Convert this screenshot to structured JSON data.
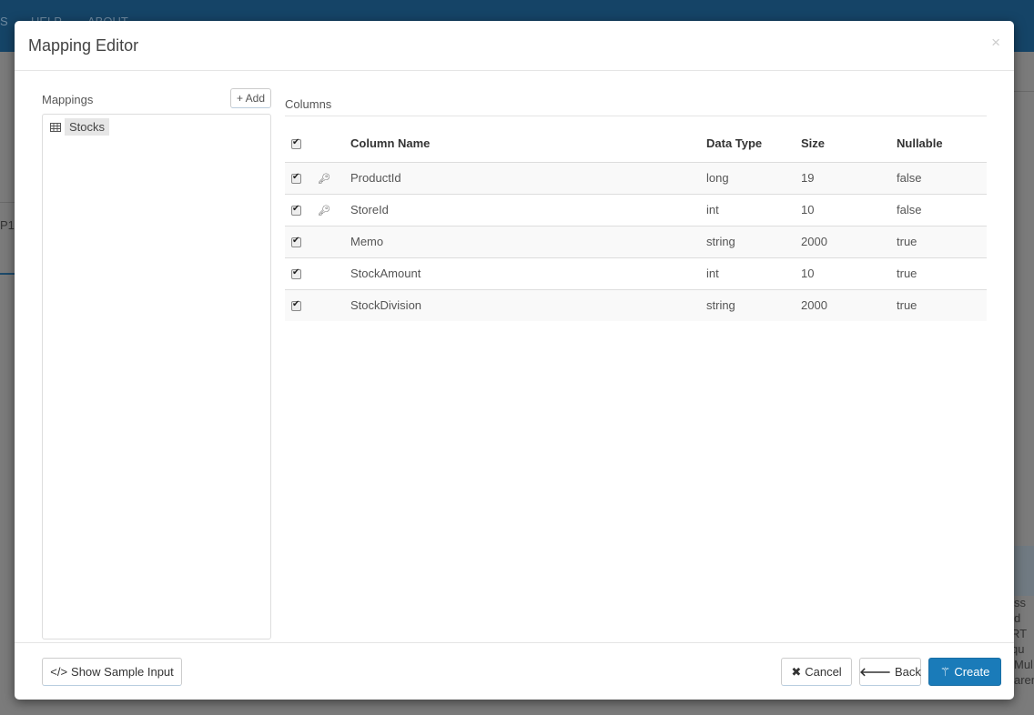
{
  "background": {
    "nav": [
      "S",
      "HELP",
      "ABOUT"
    ],
    "fragments": [
      "P1",
      "ss d",
      "RT qu",
      "Mul",
      "aren"
    ]
  },
  "modal": {
    "title": "Mapping Editor",
    "close": "×"
  },
  "mappings": {
    "header": "Mappings",
    "add_label": "+ Add",
    "items": [
      {
        "label": "Stocks",
        "icon": "table-icon"
      }
    ]
  },
  "columns": {
    "header": "Columns",
    "table_headers": [
      "Column Name",
      "Data Type",
      "Size",
      "Nullable"
    ],
    "rows": [
      {
        "checked": true,
        "key": true,
        "name": "ProductId",
        "type": "long",
        "size": "19",
        "nullable": "false"
      },
      {
        "checked": true,
        "key": true,
        "name": "StoreId",
        "type": "int",
        "size": "10",
        "nullable": "false"
      },
      {
        "checked": true,
        "key": false,
        "name": "Memo",
        "type": "string",
        "size": "2000",
        "nullable": "true"
      },
      {
        "checked": true,
        "key": false,
        "name": "StockAmount",
        "type": "int",
        "size": "10",
        "nullable": "true"
      },
      {
        "checked": true,
        "key": false,
        "name": "StockDivision",
        "type": "string",
        "size": "2000",
        "nullable": "true"
      }
    ]
  },
  "footer": {
    "sample": "Show Sample Input",
    "cancel": "Cancel",
    "back": "Back",
    "create": "Create"
  },
  "colors": {
    "primary": "#1a7bb9",
    "nav": "#154467"
  }
}
